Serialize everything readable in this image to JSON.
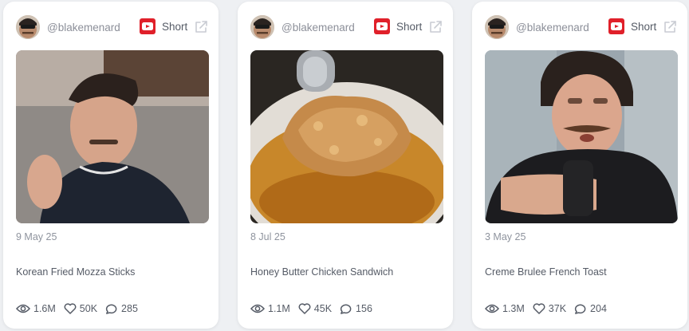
{
  "theme": {
    "youtube_red": "#e0202a",
    "text_muted": "#8c8f99"
  },
  "cards": [
    {
      "handle": "@blakemenard",
      "platform_icon": "youtube-icon",
      "platform_label": "Short",
      "date": "9 May 25",
      "title": "Korean Fried Mozza Sticks",
      "views": "1.6M",
      "likes": "50K",
      "comments": "285"
    },
    {
      "handle": "@blakemenard",
      "platform_icon": "youtube-icon",
      "platform_label": "Short",
      "date": "8 Jul 25",
      "title": "Honey Butter Chicken Sandwich",
      "views": "1.1M",
      "likes": "45K",
      "comments": "156"
    },
    {
      "handle": "@blakemenard",
      "platform_icon": "youtube-icon",
      "platform_label": "Short",
      "date": "3 May 25",
      "title": "Creme Brulee French Toast",
      "views": "1.3M",
      "likes": "37K",
      "comments": "204"
    }
  ]
}
